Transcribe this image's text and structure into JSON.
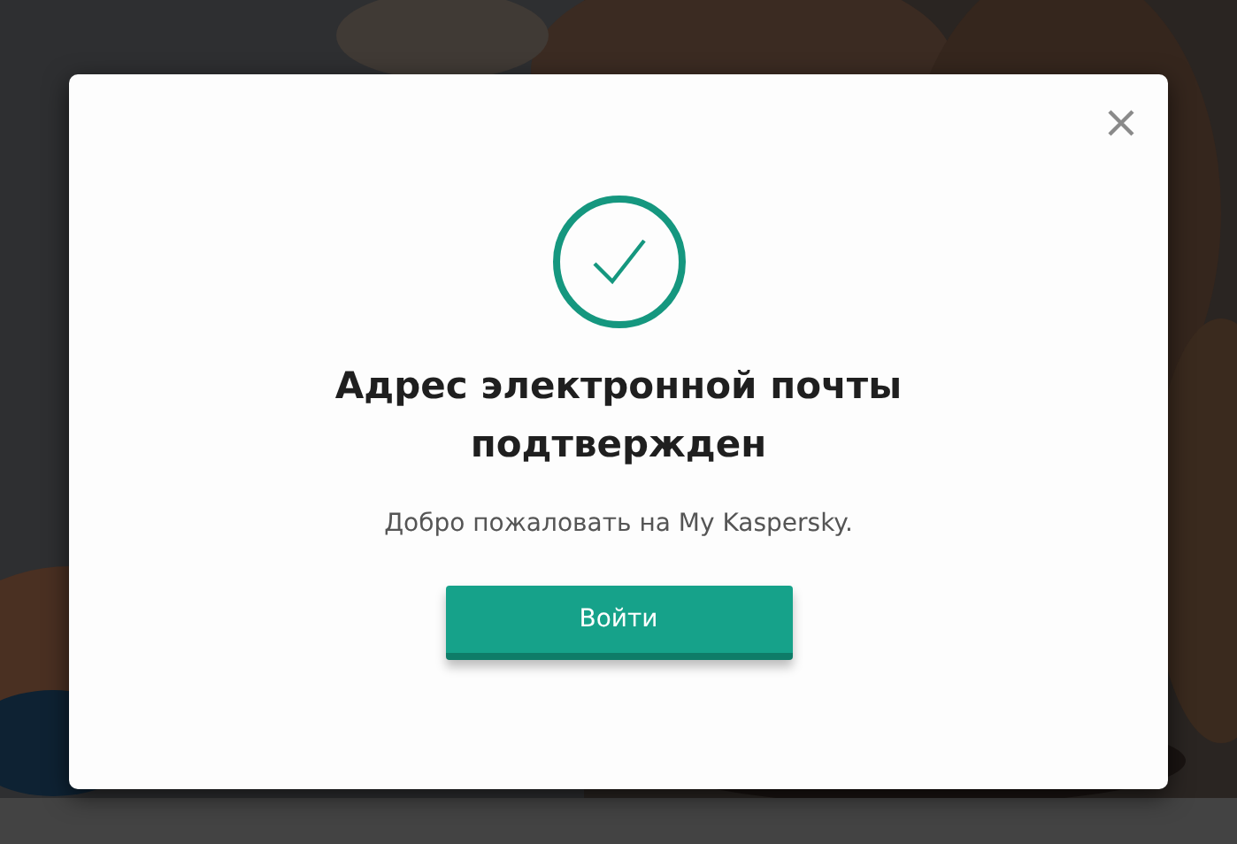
{
  "dialog": {
    "title": "Адрес электронной почты подтвержден",
    "message": "Добро пожаловать на My Kaspersky.",
    "button": "Войти"
  }
}
